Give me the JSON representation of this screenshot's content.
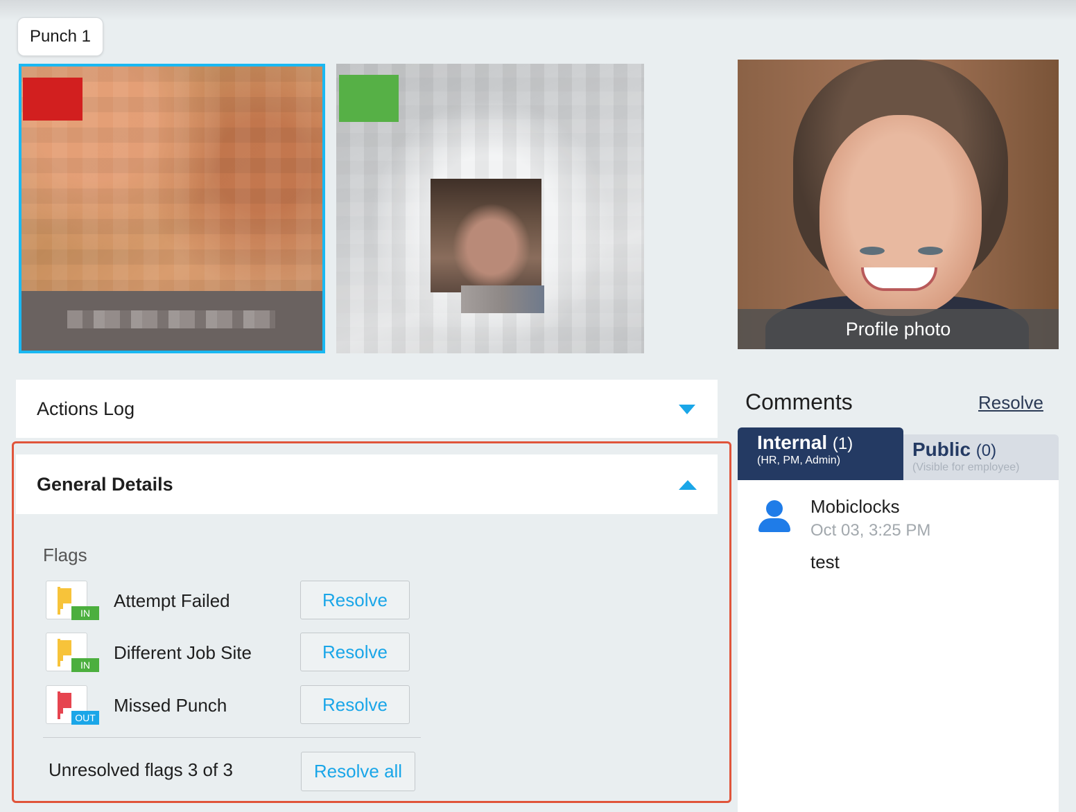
{
  "punch_tab": {
    "label": "Punch 1"
  },
  "profile": {
    "caption": "Profile photo"
  },
  "actions_log": {
    "title": "Actions Log"
  },
  "general_details": {
    "title": "General Details",
    "flags_label": "Flags",
    "flags": [
      {
        "name": "Attempt Failed",
        "badge": "IN",
        "color": "yellow",
        "resolve_label": "Resolve"
      },
      {
        "name": "Different Job Site",
        "badge": "IN",
        "color": "yellow",
        "resolve_label": "Resolve"
      },
      {
        "name": "Missed Punch",
        "badge": "OUT",
        "color": "red",
        "resolve_label": "Resolve"
      }
    ],
    "unresolved_text": "Unresolved flags 3 of 3",
    "resolve_all_label": "Resolve all"
  },
  "comments": {
    "title": "Comments",
    "resolve_label": "Resolve",
    "tabs": [
      {
        "label": "Internal",
        "count": "(1)",
        "sub": "(HR, PM, Admin)"
      },
      {
        "label": "Public",
        "count": "(0)",
        "sub": "(Visible for employee)"
      }
    ],
    "items": [
      {
        "author": "Mobiclocks",
        "time": "Oct 03, 3:25 PM",
        "text": "test"
      }
    ]
  },
  "colors": {
    "accent": "#1aa6e8",
    "highlight_outline": "#e0543a",
    "tab_active": "#243a63",
    "flag_yellow": "#f7c33a",
    "flag_red": "#e6444f",
    "badge_in": "#4caf3e",
    "badge_out": "#1aa6e8"
  }
}
